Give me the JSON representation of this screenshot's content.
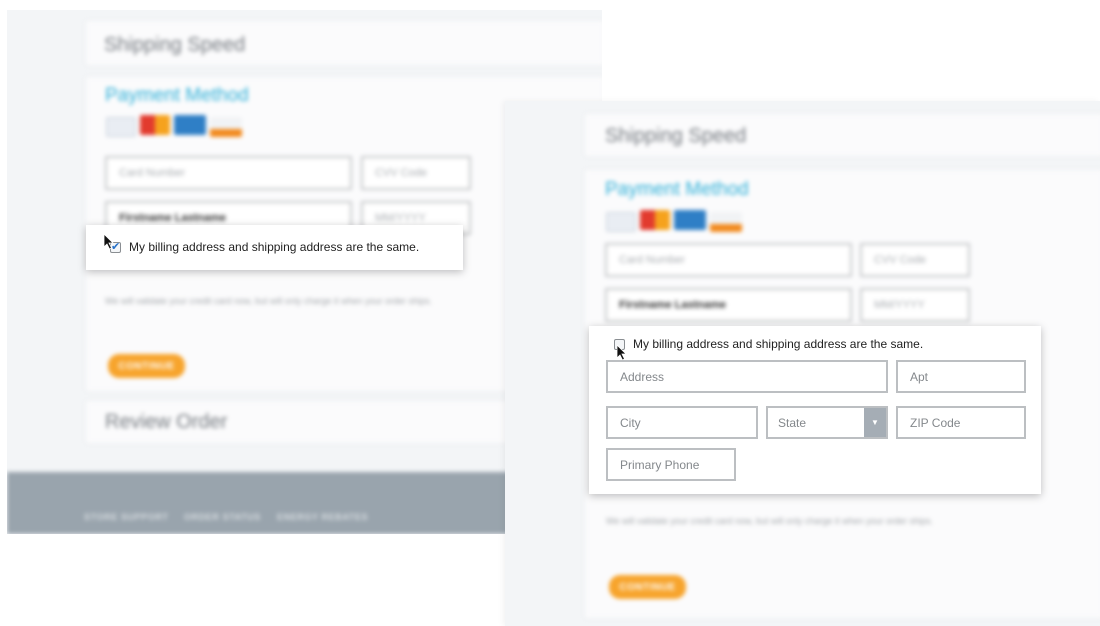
{
  "left_screen": {
    "shipping_speed_title": "Shipping Speed",
    "payment_method_title": "Payment Method",
    "card_logos": [
      "VISA",
      "MC",
      "AMEX",
      "DISCOVER"
    ],
    "card_number_placeholder": "Card Number",
    "cvv_placeholder": "CVV Code",
    "name_value": "Firstname Lastname",
    "expiry_placeholder": "MM/YYYY",
    "billing_same_label": "My billing address and shipping address are the same.",
    "billing_same_checked": true,
    "legal_text": "We will validate your credit card now, but will only charge it when your order ships.",
    "continue_label": "CONTINUE",
    "review_order_title": "Review Order",
    "footer_links": [
      "STORE SUPPORT",
      "ORDER STATUS",
      "ENERGY REBATES"
    ]
  },
  "right_screen": {
    "shipping_speed_title": "Shipping Speed",
    "payment_method_title": "Payment Method",
    "card_logos": [
      "VISA",
      "MC",
      "AMEX",
      "DISCOVER"
    ],
    "card_number_placeholder": "Card Number",
    "cvv_placeholder": "CVV Code",
    "name_value": "Firstname Lastname",
    "expiry_placeholder": "MM/YYYY",
    "billing_same_label": "My billing address and shipping address are the same.",
    "billing_same_checked": false,
    "address_placeholder": "Address",
    "apt_placeholder": "Apt",
    "city_placeholder": "City",
    "state_placeholder": "State",
    "zip_placeholder": "ZIP Code",
    "phone_placeholder": "Primary Phone",
    "legal_text": "We will validate your credit card now, but will only charge it when your order ships.",
    "continue_label": "CONTINUE"
  },
  "colors": {
    "accent_blue": "#2fb0d8",
    "continue_orange": "#f7a42c",
    "footer_gray": "#99a4ad"
  }
}
